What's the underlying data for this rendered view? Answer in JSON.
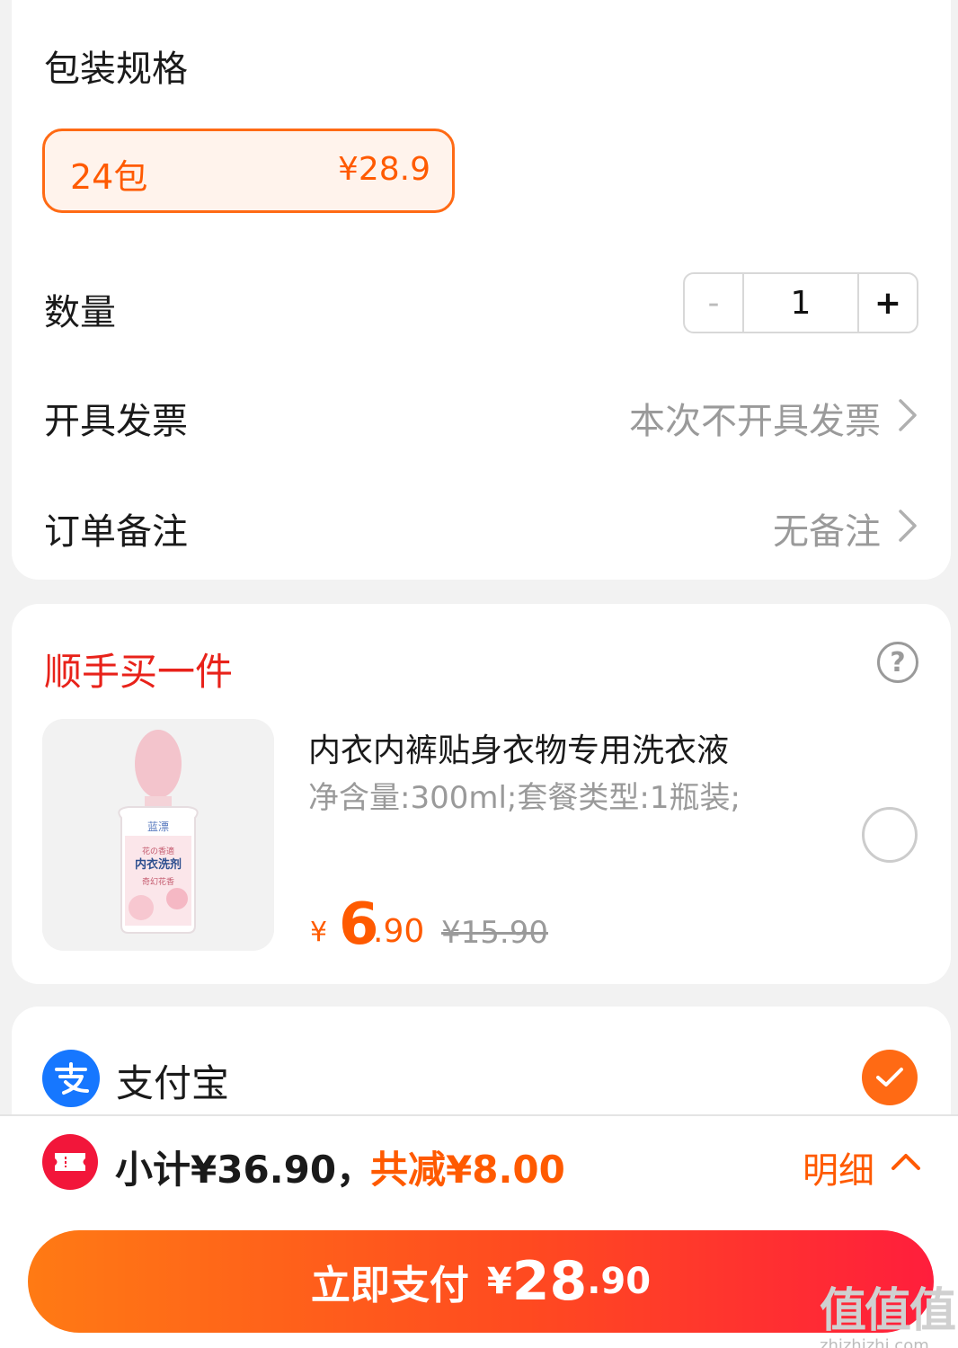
{
  "order": {
    "spec_label": "包装规格",
    "spec_option": {
      "name": "24包",
      "price": "¥28.9"
    },
    "quantity_label": "数量",
    "quantity": {
      "minus": "-",
      "value": "1",
      "plus": "+"
    },
    "invoice_label": "开具发票",
    "invoice_value": "本次不开具发票",
    "remark_label": "订单备注",
    "remark_value": "无备注"
  },
  "addon": {
    "title": "顺手买一件",
    "help": "?",
    "product": {
      "title": "内衣内裤贴身衣物专用洗衣液",
      "subtitle": "净含量:300ml;套餐类型:1瓶装;",
      "price_yen": "¥",
      "price_int": "6",
      "price_dec": ".90",
      "original_price": "¥15.90",
      "image_text": {
        "brand": "蓝漂",
        "line1": "花の香適",
        "line2": "内衣洗剂",
        "line3": "奇幻花香"
      }
    }
  },
  "payment": {
    "method": "支付宝"
  },
  "footer": {
    "subtotal": "小计¥36.90，",
    "discount": "共减¥8.00",
    "detail": "明细",
    "pay_label": "立即支付",
    "pay_yen": "¥",
    "pay_int": "28",
    "pay_dec": ".90"
  },
  "watermark": {
    "logo": "值值值",
    "url": "zhizhizhi.com"
  },
  "colors": {
    "accent": "#ff5a00",
    "red_title": "#e8221a",
    "alipay": "#1677ff",
    "coupon": "#f2163a",
    "grey_text": "#9a9a9a"
  }
}
